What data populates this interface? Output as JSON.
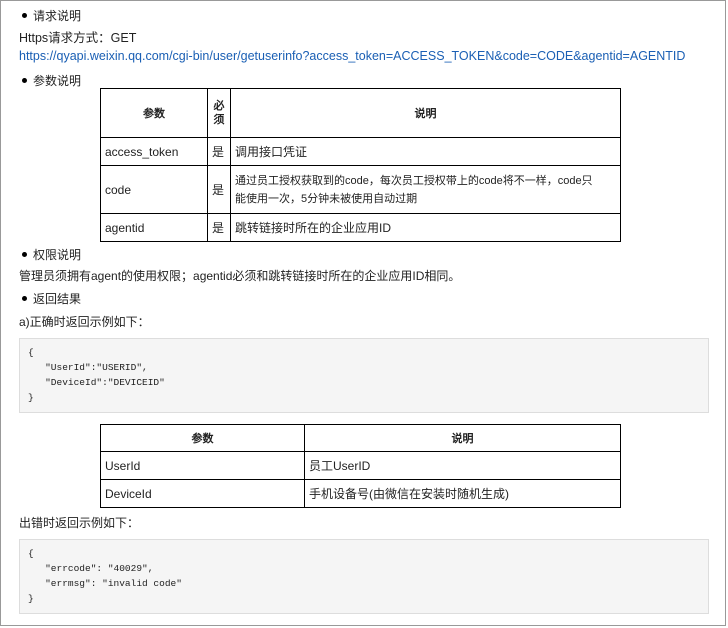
{
  "sections": {
    "request": "请求说明",
    "params": "参数说明",
    "permission": "权限说明",
    "result": "返回结果"
  },
  "request": {
    "method_line": "Https请求方式：GET",
    "url": "https://qyapi.weixin.qq.com/cgi-bin/user/getuserinfo?access_token=ACCESS_TOKEN&code=CODE&agentid=AGENTID"
  },
  "params_table": {
    "headers": [
      "参数",
      "必须",
      "说明"
    ],
    "rows": [
      {
        "name": "access_token",
        "required": "是",
        "desc": "调用接口凭证"
      },
      {
        "name": "code",
        "required": "是",
        "desc_line1": "通过员工授权获取到的code，每次员工授权带上的code将不一样，code只",
        "desc_line2": "能使用一次，5分钟未被使用自动过期"
      },
      {
        "name": "agentid",
        "required": "是",
        "desc": "跳转链接时所在的企业应用ID"
      }
    ]
  },
  "permission_text": "管理员须拥有agent的使用权限；agentid必须和跳转链接时所在的企业应用ID相同。",
  "success": {
    "intro": "a)正确时返回示例如下：",
    "code_lines": [
      "{",
      "   \"UserId\":\"USERID\",",
      "   \"DeviceId\":\"DEVICEID\"",
      "}"
    ]
  },
  "result_table": {
    "headers": [
      "参数",
      "说明"
    ],
    "rows": [
      {
        "name": "UserId",
        "desc": "员工UserID"
      },
      {
        "name": "DeviceId",
        "desc": "手机设备号(由微信在安装时随机生成)"
      }
    ]
  },
  "error": {
    "intro": "出错时返回示例如下：",
    "code_lines": [
      "{",
      "   \"errcode\": \"40029\",",
      "   \"errmsg\": \"invalid code\"",
      "}"
    ]
  }
}
